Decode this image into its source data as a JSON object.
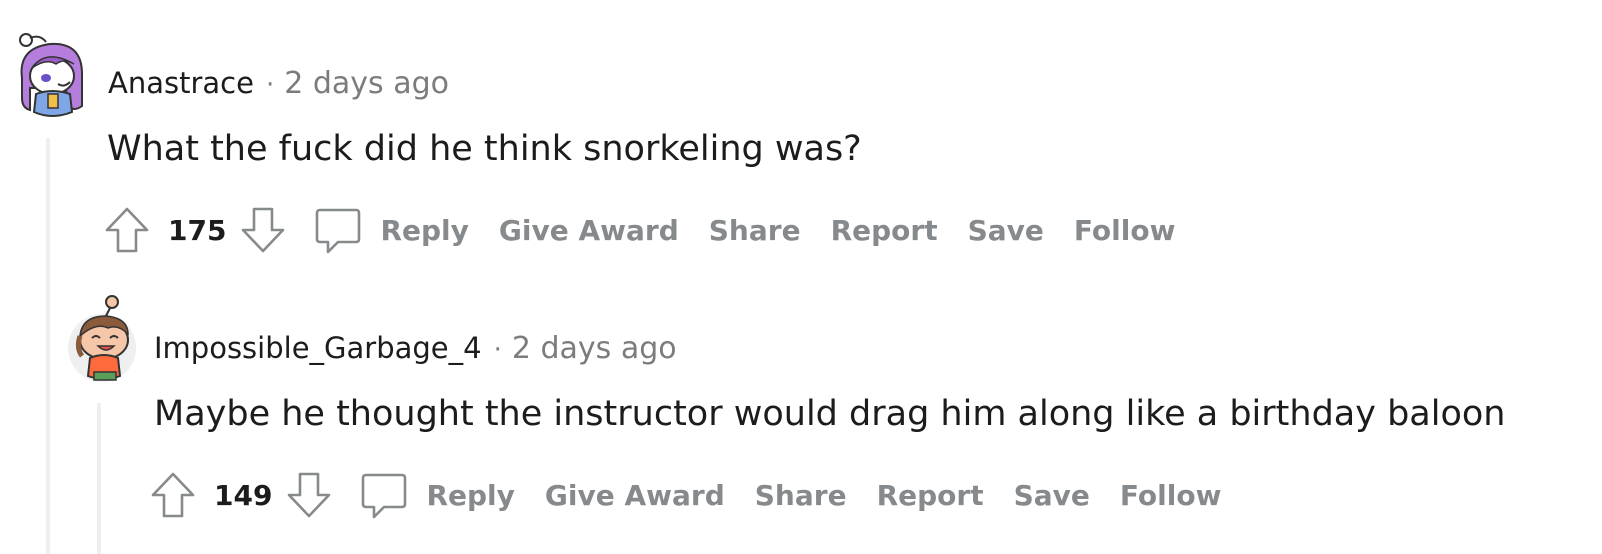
{
  "comments": [
    {
      "author": "Anastrace",
      "separator": "·",
      "time": "2 days ago",
      "body": "What the fuck did he think snorkeling was?",
      "score": "175",
      "avatar_icon": "snoo-avatar-purple-hair-icon",
      "actions": {
        "reply": "Reply",
        "give_award": "Give Award",
        "share": "Share",
        "report": "Report",
        "save": "Save",
        "follow": "Follow"
      }
    },
    {
      "author": "Impossible_Garbage_4",
      "separator": "·",
      "time": "2 days ago",
      "body": "Maybe he thought the instructor would drag him along like a birthday baloon",
      "score": "149",
      "avatar_icon": "snoo-avatar-brown-hair-icon",
      "actions": {
        "reply": "Reply",
        "give_award": "Give Award",
        "share": "Share",
        "report": "Report",
        "save": "Save",
        "follow": "Follow"
      }
    }
  ],
  "colors": {
    "text": "#1c1c1c",
    "meta": "#7c7c7c",
    "action": "#878a8c",
    "thread_line": "#edeff1"
  }
}
